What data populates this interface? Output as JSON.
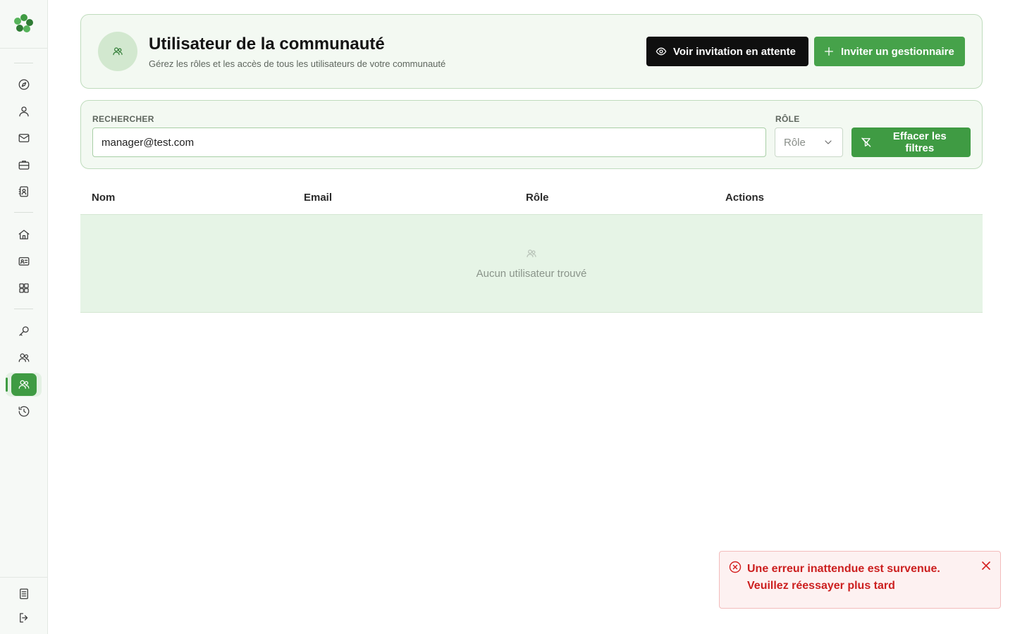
{
  "sidebar": {
    "logo_icon": "clover-logo-icon",
    "items": [
      {
        "icon": "compass-icon"
      },
      {
        "icon": "user-icon"
      },
      {
        "icon": "mail-icon"
      },
      {
        "icon": "briefcase-icon"
      },
      {
        "icon": "contact-book-icon"
      },
      {
        "icon": "home-icon"
      },
      {
        "icon": "id-card-icon"
      },
      {
        "icon": "grid-icon"
      },
      {
        "icon": "key-icon"
      },
      {
        "icon": "users-icon"
      },
      {
        "icon": "users-icon",
        "active": true
      },
      {
        "icon": "history-icon"
      }
    ],
    "bottom_items": [
      {
        "icon": "document-icon"
      },
      {
        "icon": "logout-icon"
      }
    ],
    "accent_color": "#3f9b43"
  },
  "header": {
    "title": "Utilisateur de la communauté",
    "subtitle": "Gérez les rôles et les accès de tous les utilisateurs de votre communauté",
    "avatar_icon": "users-icon",
    "view_pending_label": "Voir invitation en attente",
    "view_pending_icon": "eye-icon",
    "invite_label": "Inviter un gestionnaire",
    "invite_icon": "plus-icon"
  },
  "filters": {
    "search_label": "RECHERCHER",
    "search_value": "manager@test.com",
    "role_label": "RÔLE",
    "role_placeholder": "Rôle",
    "clear_label": "Effacer les filtres",
    "clear_icon": "filter-off-icon"
  },
  "table": {
    "columns": [
      "Nom",
      "Email",
      "Rôle",
      "Actions"
    ],
    "empty_icon": "users-icon",
    "empty_text": "Aucun utilisateur trouvé"
  },
  "toast": {
    "type": "error",
    "icon": "error-circle-icon",
    "line1": "Une erreur inattendue est survenue.",
    "line2": "Veuillez réessayer plus tard",
    "close_icon": "close-icon"
  },
  "colors": {
    "primary_green": "#46a24a",
    "dark_button": "#0f0f0f",
    "error_red": "#cc1f1f"
  }
}
